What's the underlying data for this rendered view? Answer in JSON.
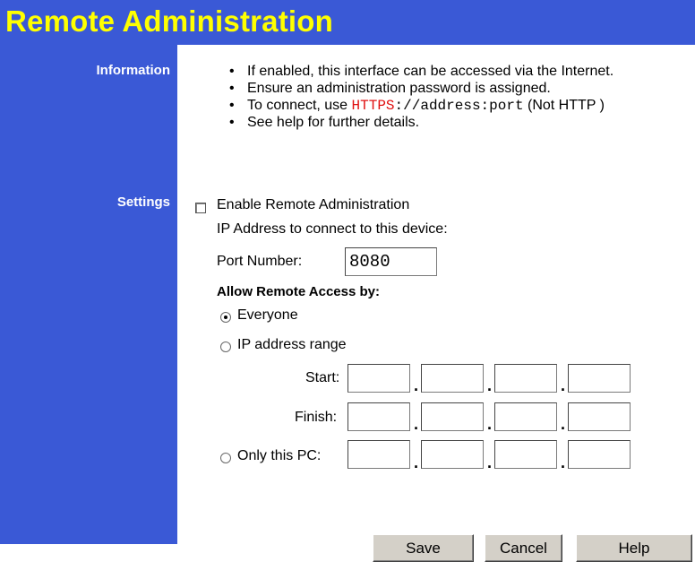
{
  "page": {
    "title": "Remote Administration"
  },
  "sections": {
    "information": "Information",
    "settings": "Settings"
  },
  "info": {
    "bullet1": "If enabled, this interface can be accessed via the Internet.",
    "bullet2": "Ensure an administration password is assigned.",
    "bullet3_prefix": "To connect, use ",
    "bullet3_https": "HTTPS",
    "bullet3_url": "://address:port",
    "bullet3_suffix": " (Not HTTP )",
    "bullet4": "See help for further details."
  },
  "settings": {
    "enable_label": "Enable Remote Administration",
    "enable_checked": false,
    "ip_connect_label": "IP Address to connect to this device:",
    "port_label": "Port Number:",
    "port_value": "8080",
    "allow_heading": "Allow Remote Access by:",
    "everyone_label": "Everyone",
    "everyone_selected": true,
    "range_label": "IP address range",
    "start_label": "Start:",
    "finish_label": "Finish:",
    "only_pc_label": "Only this PC:",
    "ip_sep": "."
  },
  "buttons": {
    "save": "Save",
    "cancel": "Cancel",
    "help": "Help"
  },
  "colors": {
    "sidebar": "#3a59d6",
    "title_text": "#ffff00",
    "https_text": "#e01010"
  }
}
